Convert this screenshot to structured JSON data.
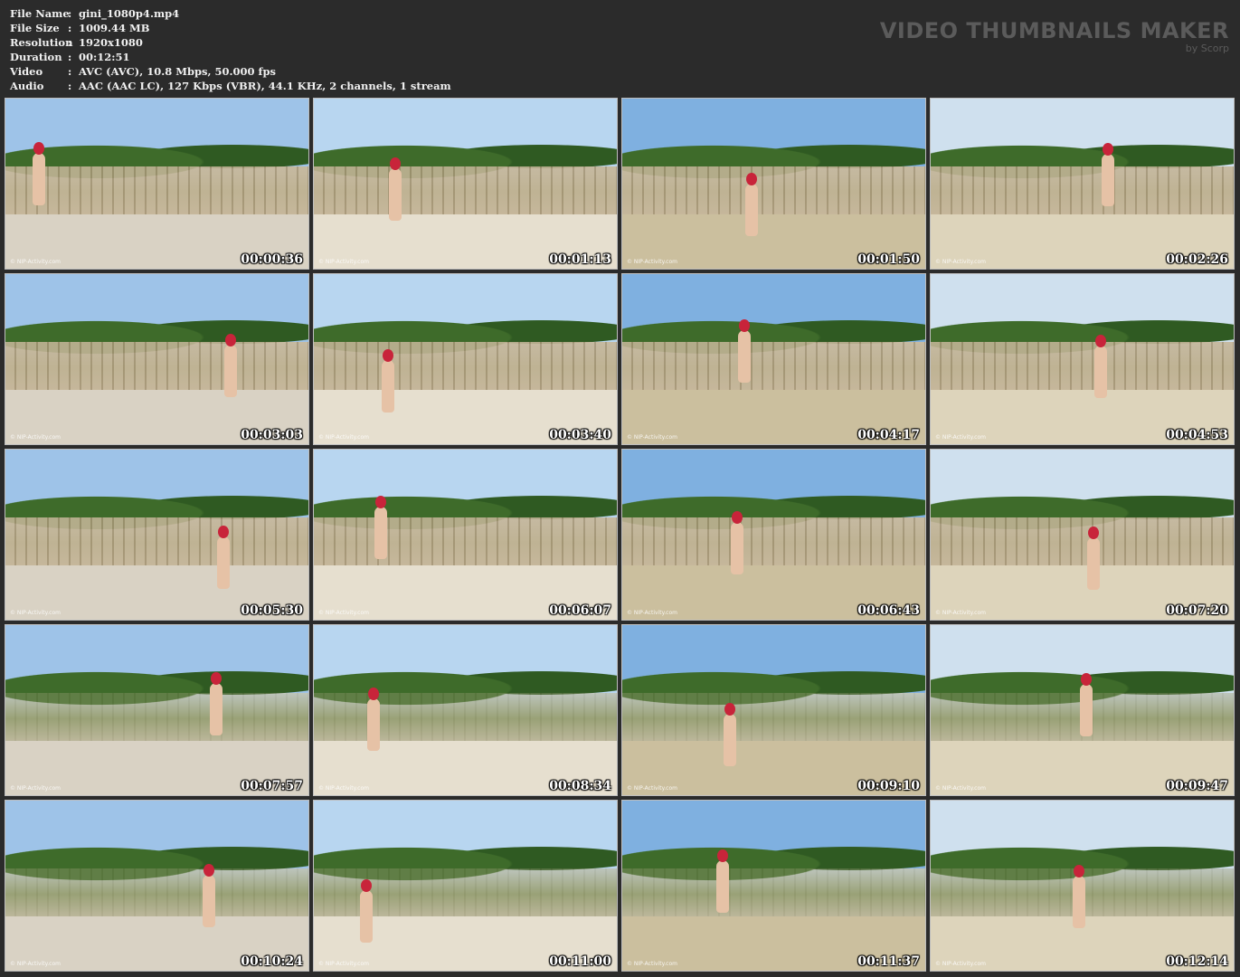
{
  "info": {
    "rows": [
      {
        "key": "File Name",
        "sep": ":",
        "value": "gini_1080p4.mp4"
      },
      {
        "key": "File Size",
        "sep": ":",
        "value": "1009.44 MB"
      },
      {
        "key": "Resolution",
        "sep": ":",
        "value": "1920x1080"
      },
      {
        "key": "Duration",
        "sep": ":",
        "value": "00:12:51"
      },
      {
        "key": "Video",
        "sep": ":",
        "value": "AVC (AVC), 10.8 Mbps, 50.000 fps"
      },
      {
        "key": "Audio",
        "sep": ":",
        "value": "AAC (AAC LC), 127 Kbps (VBR), 44.1 KHz, 2 channels, 1 stream"
      }
    ]
  },
  "brand": {
    "title": "VIDEO THUMBNAILS MAKER",
    "subtitle": "by Scorp"
  },
  "watermark": "© NIP-Activity.com",
  "thumbnails": [
    {
      "time": "00:00:36"
    },
    {
      "time": "00:01:13"
    },
    {
      "time": "00:01:50"
    },
    {
      "time": "00:02:26"
    },
    {
      "time": "00:03:03"
    },
    {
      "time": "00:03:40"
    },
    {
      "time": "00:04:17"
    },
    {
      "time": "00:04:53"
    },
    {
      "time": "00:05:30"
    },
    {
      "time": "00:06:07"
    },
    {
      "time": "00:06:43"
    },
    {
      "time": "00:07:20"
    },
    {
      "time": "00:07:57"
    },
    {
      "time": "00:08:34"
    },
    {
      "time": "00:09:10"
    },
    {
      "time": "00:09:47"
    },
    {
      "time": "00:10:24"
    },
    {
      "time": "00:11:00"
    },
    {
      "time": "00:11:37"
    },
    {
      "time": "00:12:14"
    }
  ],
  "colors": {
    "background": "#2b2b2b",
    "brand_text": "#5b5b5b",
    "thumb_border": "#bdbdbd"
  }
}
